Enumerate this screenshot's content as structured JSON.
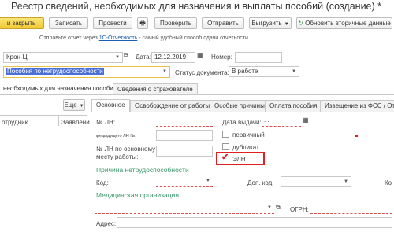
{
  "window": {
    "title": "Реестр сведений, необходимых для назначения и выплаты пособий (создание)",
    "modified_marker": "*"
  },
  "toolbar": {
    "post_close_label": "и закрыть",
    "save_label": "Записать",
    "post_label": "Провести",
    "check_label": "Проверить",
    "send_label": "Отправить",
    "upload_label": "Выгрузить",
    "refresh_secondary_label": "Обновить вторичные данные"
  },
  "hint": {
    "prefix": "Отправьте отчет через",
    "link": "1С-Отчетность",
    "suffix": "- самый удобный способ сдачи отчетности."
  },
  "header": {
    "organization_value": "Крон-Ц",
    "date_label": "Дата:",
    "date_value": "12.12.2019",
    "number_label": "Номер:",
    "number_value": "",
    "type_value": "Пособия по нетрудоспособности",
    "status_label": "Статус документа:",
    "status_value": "В работе"
  },
  "outer_tabs": [
    {
      "label": "необходимых для назначения пособия"
    },
    {
      "label": "Сведения о страхователе"
    }
  ],
  "left_panel": {
    "more_label": "Еще",
    "columns": [
      "отрудник",
      "Заявлени"
    ]
  },
  "inner_tabs": [
    {
      "label": "Основное"
    },
    {
      "label": "Освобождение от работы"
    },
    {
      "label": "Особые причины"
    },
    {
      "label": "Оплата пособия"
    },
    {
      "label": "Извещение из ФСС / Отка"
    }
  ],
  "form": {
    "ln_number_label": "№ ЛН:",
    "ln_number_value": "",
    "issue_date_label": "Дата выдачи:",
    "issue_date_value": ".  .",
    "prev_ln_label": "предыдущего ЛН №:",
    "primary_label": "первичный",
    "duplicate_label": "дубликат",
    "main_ln_label_1": "№ ЛН по основному",
    "main_ln_label_2": "месту работы:",
    "eln_label": "ЭЛН",
    "cause_section": "Причина нетрудоспособности",
    "code_label": "Код:",
    "extra_code_label": "Доп. код:",
    "k_label": "Ко",
    "med_org_section": "Медицинская организация",
    "ogrn_label": "ОГРН:",
    "address_label": "Адрес:"
  },
  "colors": {
    "accent": "#f2c832",
    "section": "#3a9a6b",
    "highlight": "#e02020",
    "selection": "#4a6fd6"
  }
}
